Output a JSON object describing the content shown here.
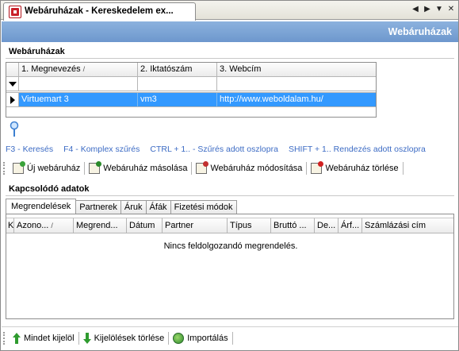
{
  "window": {
    "tab_title": "Webáruházak - Kereskedelem ex...",
    "banner_title": "Webáruházak"
  },
  "stores_section": {
    "title": "Webáruházak",
    "columns": [
      "1. Megnevezés",
      "2. Iktatószám",
      "3. Webcím"
    ],
    "sort_indicator": "/",
    "rows": [
      {
        "name": "Virtuemart 3",
        "code": "vm3",
        "url": "http://www.weboldalam.hu/"
      }
    ]
  },
  "hints": [
    "F3 - Keresés",
    "F4 - Komplex szűrés",
    "CTRL + 1.. - Szűrés adott oszlopra",
    "SHIFT + 1.. Rendezés adott oszlopra"
  ],
  "toolbar": {
    "new_label": "Új webáruház",
    "copy_label": "Webáruház másolása",
    "edit_label": "Webáruház módosítása",
    "delete_label": "Webáruház törlése"
  },
  "related": {
    "title": "Kapcsolódó adatok",
    "tabs": [
      "Megrendelések",
      "Partnerek",
      "Áruk",
      "Áfák",
      "Fizetési módok"
    ],
    "columns": [
      "K",
      "Azono...",
      "Megrend...",
      "Dátum",
      "Partner",
      "Típus",
      "Bruttó ...",
      "De...",
      "Árf...",
      "Számlázási cím"
    ],
    "sort_indicator": "/",
    "empty_message": "Nincs feldolgozandó megrendelés."
  },
  "bottom_toolbar": {
    "select_all_label": "Mindet kijelöl",
    "clear_selection_label": "Kijelölések törlése",
    "import_label": "Importálás"
  },
  "colors": {
    "banner": "#7aa3d4",
    "selection": "#3399ff",
    "hint_text": "#3c6bc4"
  }
}
